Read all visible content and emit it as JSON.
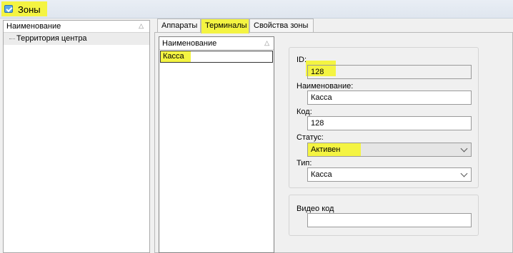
{
  "window": {
    "title": "Зоны",
    "icon": "zones-app-icon"
  },
  "tree": {
    "column_header": "Наименование",
    "sort_icon": "sort-arrow-icon",
    "items": [
      {
        "label": "Территория центра"
      }
    ]
  },
  "tabs": [
    {
      "label": "Аппараты",
      "active": false
    },
    {
      "label": "Терминалы",
      "active": true
    },
    {
      "label": "Свойства зоны",
      "active": false
    }
  ],
  "terminals_list": {
    "column_header": "Наименование",
    "rows": [
      {
        "label": "Касса",
        "selected": true
      }
    ]
  },
  "details": {
    "id_label": "ID:",
    "id_value": "128",
    "name_label": "Наименование:",
    "name_value": "Касса",
    "code_label": "Код:",
    "code_value": "128",
    "status_label": "Статус:",
    "status_value": "Активен",
    "type_label": "Тип:",
    "type_value": "Касса",
    "video_label": "Видео код",
    "video_value": ""
  },
  "colors": {
    "highlight": "#f4f442",
    "panel": "#f0f0f0",
    "border": "#9a9a9a"
  }
}
